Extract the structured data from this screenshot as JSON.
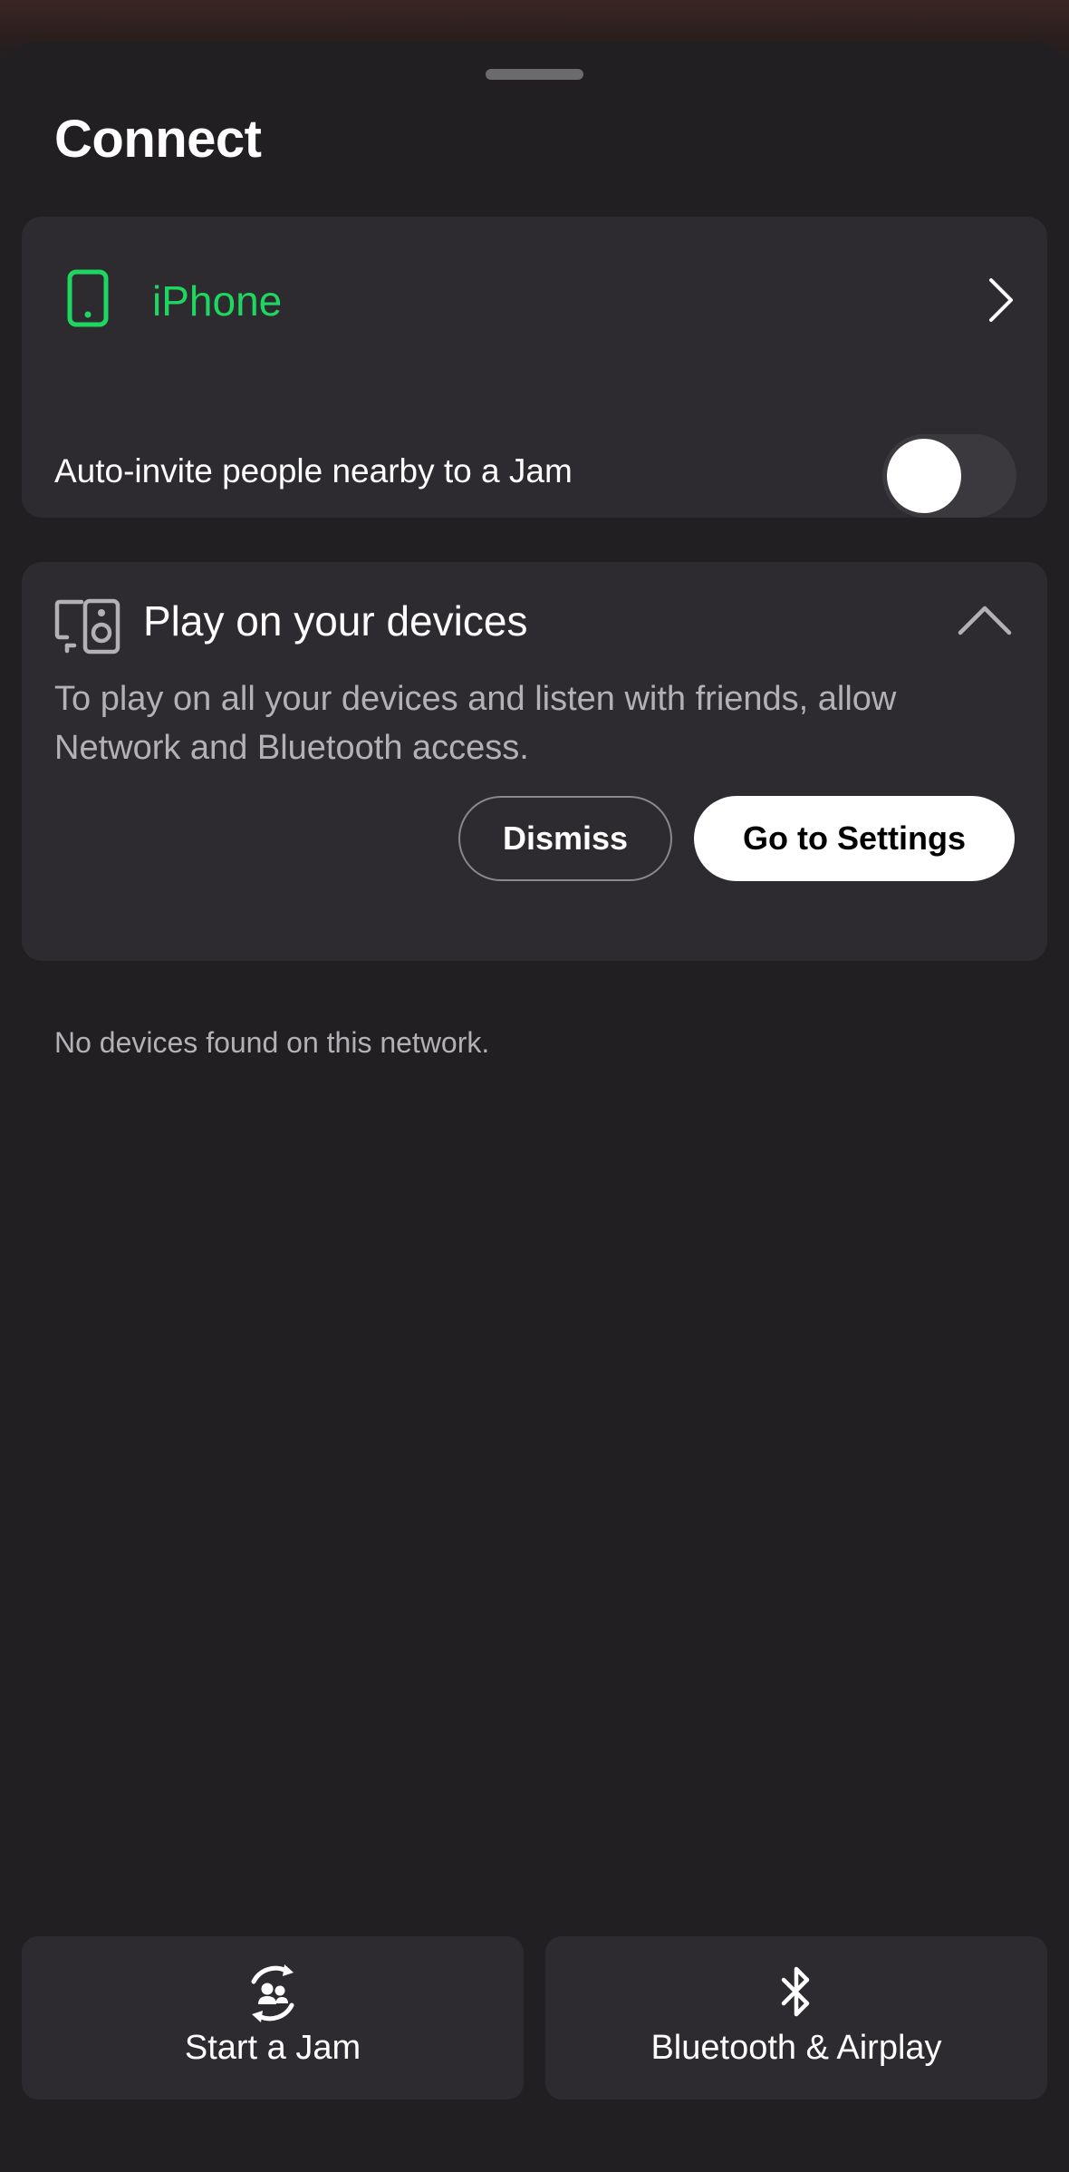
{
  "sheet": {
    "title": "Connect"
  },
  "current_device": {
    "name": "iPhone",
    "icon": "phone-icon",
    "accent_color": "#1ed760"
  },
  "jam_setting": {
    "label": "Auto-invite people nearby to a Jam",
    "enabled": false
  },
  "devices_card": {
    "title": "Play on your devices",
    "icon": "devices-speaker-icon",
    "description": "To play on all your devices and listen with friends, allow Network and Bluetooth access.",
    "dismiss_label": "Dismiss",
    "settings_label": "Go to Settings"
  },
  "status": {
    "no_devices": "No devices found on this network."
  },
  "actions": {
    "start_jam_label": "Start a Jam",
    "start_jam_icon": "jam-icon",
    "bluetooth_label": "Bluetooth & Airplay",
    "bluetooth_icon": "bluetooth-icon"
  }
}
